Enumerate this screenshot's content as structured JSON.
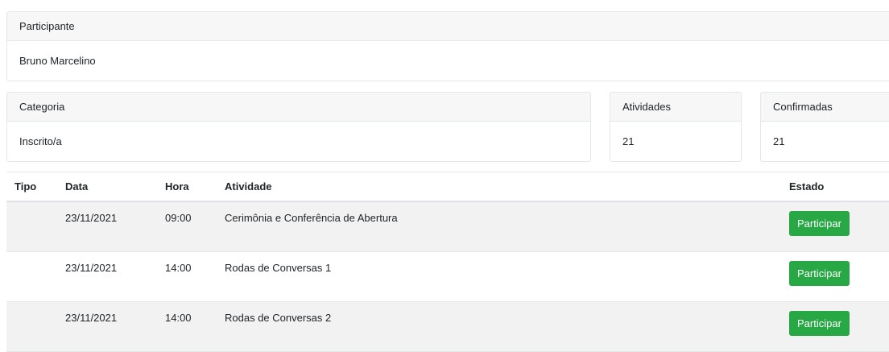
{
  "participant": {
    "header": "Participante",
    "name": "Bruno Marcelino"
  },
  "category": {
    "header": "Categoria",
    "value": "Inscrito/a"
  },
  "activities_count": {
    "header": "Atividades",
    "value": "21"
  },
  "confirmed_count": {
    "header": "Confirmadas",
    "value": "21"
  },
  "table": {
    "columns": [
      "Tipo",
      "Data",
      "Hora",
      "Atividade",
      "Estado"
    ],
    "rows": [
      {
        "tipo": "",
        "data": "23/11/2021",
        "hora": "09:00",
        "atividade": "Cerimônia e Conferência de Abertura",
        "action": "Participar"
      },
      {
        "tipo": "",
        "data": "23/11/2021",
        "hora": "14:00",
        "atividade": "Rodas de Conversas 1",
        "action": "Participar"
      },
      {
        "tipo": "",
        "data": "23/11/2021",
        "hora": "14:00",
        "atividade": "Rodas de Conversas 2",
        "action": "Participar"
      }
    ]
  },
  "colors": {
    "button_bg": "#28a745",
    "stripe_bg": "#f2f2f2",
    "header_bg": "#f7f7f7"
  }
}
